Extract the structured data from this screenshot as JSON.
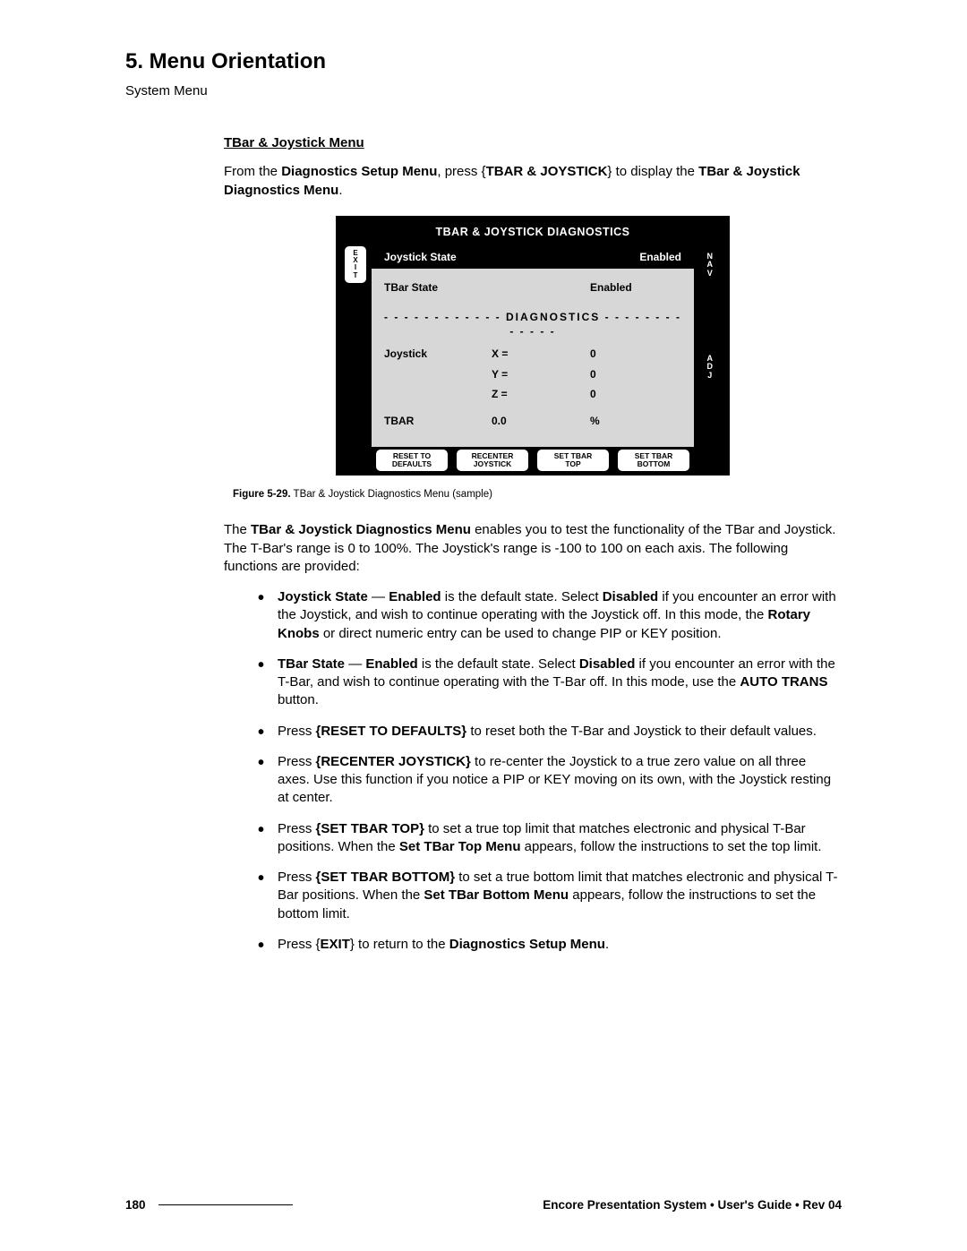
{
  "chapter": "5.  Menu Orientation",
  "breadcrumb": "System Menu",
  "section": "TBar & Joystick Menu",
  "intro": {
    "pre": "From the ",
    "b1": "Diagnostics Setup Menu",
    "mid1": ", press {",
    "b2": "TBAR & JOYSTICK",
    "mid2": "} to display the ",
    "b3": "TBar & Joystick Diagnostics Menu",
    "end": "."
  },
  "panel": {
    "title": "TBAR & JOYSTICK DIAGNOSTICS",
    "exit_lines": "E\nX\nI\nT",
    "nav_lines": "N\nA\nV",
    "adj_lines": "A\nD\nJ",
    "sel": {
      "label": "Joystick State",
      "value": "Enabled"
    },
    "row_tbarstate": {
      "label": "TBar State",
      "value": "Enabled"
    },
    "diag_header": "- - - - - - - - - - - -    DIAGNOSTICS   - - - - - - - - - - - - -",
    "joystick_label": "Joystick",
    "row_x": {
      "mid": "X   =",
      "val": "0"
    },
    "row_y": {
      "mid": "Y   =",
      "val": "0"
    },
    "row_z": {
      "mid": "Z   =",
      "val": "0"
    },
    "row_tbar": {
      "label": "TBAR",
      "mid": "0.0",
      "val": "%"
    },
    "buttons": {
      "reset": "RESET TO\nDEFAULTS",
      "recenter": "RECENTER\nJOYSTICK",
      "settop": "SET TBAR\nTOP",
      "setbottom": "SET TBAR\nBOTTOM"
    }
  },
  "caption": {
    "b": "Figure 5-29.",
    "rest": "  TBar & Joystick Diagnostics Menu  (sample)"
  },
  "para": {
    "pre": "The ",
    "b": "TBar & Joystick Diagnostics Menu",
    "rest": " enables you to test the functionality of the TBar and Joystick.  The T-Bar's range is 0 to 100%.  The Joystick's range is -100 to 100 on each axis.  The following functions are provided:"
  },
  "bul1": {
    "b1": "Joystick State",
    "dash": " — ",
    "b2": "Enabled",
    "t1": " is the default state.  Select ",
    "b3": "Disabled",
    "t2": " if you encounter an error with the Joystick, and wish to continue operating with the Joystick off.  In this mode, the ",
    "b4": "Rotary Knobs",
    "t3": " or direct numeric entry can be used to change PIP or KEY position."
  },
  "bul2": {
    "b1": "TBar State",
    "dash": " — ",
    "b2": "Enabled",
    "t1": " is the default state.  Select ",
    "b3": "Disabled",
    "t2": " if you encounter an error with the T-Bar, and wish to continue operating with the T-Bar off.  In this mode, use the ",
    "b4": "AUTO TRANS",
    "t3": " button."
  },
  "bul3": {
    "t0": "Press ",
    "b1": "{RESET TO DEFAULTS}",
    "t1": " to reset both the T-Bar and Joystick to their default values."
  },
  "bul4": {
    "t0": "Press ",
    "b1": "{RECENTER JOYSTICK}",
    "t1": " to re-center the Joystick to a true zero value on all three axes.  Use this function if you notice a PIP or KEY moving on its own, with the Joystick resting at center."
  },
  "bul5": {
    "t0": "Press ",
    "b1": "{SET TBAR TOP}",
    "t1": " to set a true top limit that matches electronic and physical T-Bar positions.  When the ",
    "b2": "Set TBar Top Menu",
    "t2": " appears, follow the instructions to set the top limit."
  },
  "bul6": {
    "t0": "Press ",
    "b1": "{SET TBAR BOTTOM}",
    "t1": " to set a true bottom limit that matches electronic and physical T-Bar positions.  When the ",
    "b2": "Set TBar Bottom Menu",
    "t2": " appears, follow the instructions to set the bottom limit."
  },
  "bul7": {
    "t0": "Press {",
    "b1": "EXIT",
    "t1": "} to return to the ",
    "b2": "Diagnostics Setup Menu",
    "t2": "."
  },
  "footer": {
    "page": "180",
    "text": "Encore Presentation System  •  User's Guide  •  Rev 04"
  }
}
